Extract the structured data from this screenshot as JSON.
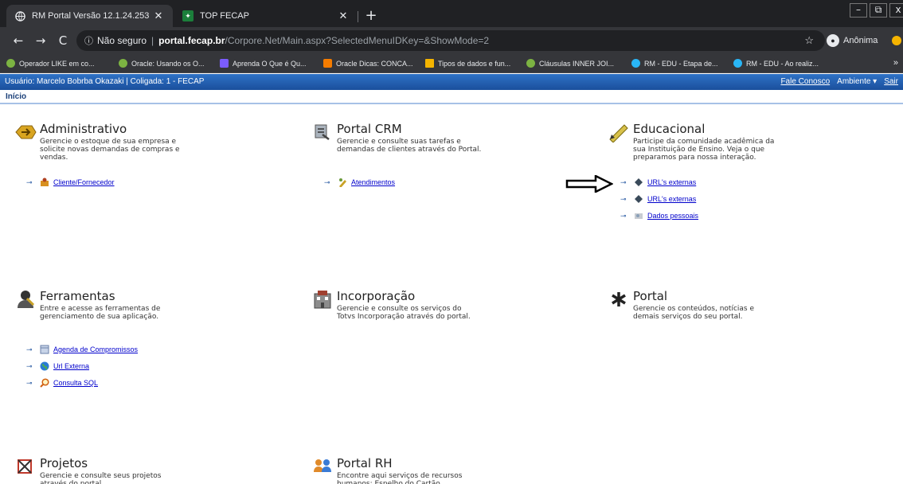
{
  "browser": {
    "tabs": [
      {
        "title": "RM Portal Versão 12.1.24.253",
        "active": true
      },
      {
        "title": "TOP FECAP",
        "active": false
      }
    ],
    "window_controls": [
      "–",
      "⧉",
      "x"
    ],
    "address": {
      "security": "Não seguro",
      "host": "portal.fecap.br",
      "path": "/Corpore.Net/Main.aspx?SelectedMenuIDKey=&ShowMode=2"
    },
    "incognito_label": "Anônima",
    "bookmarks": [
      {
        "label": "Operador LIKE em co...",
        "color": "#7cb342"
      },
      {
        "label": "Oracle: Usando os O...",
        "color": "#7cb342"
      },
      {
        "label": "Aprenda O Que é Qu...",
        "color": "#7b5cff"
      },
      {
        "label": "Oracle Dicas: CONCA...",
        "color": "#f57c00"
      },
      {
        "label": "Tipos de dados e fun...",
        "color": "#f4b400"
      },
      {
        "label": "Cláusulas INNER JOI...",
        "color": "#7cb342"
      },
      {
        "label": "RM - EDU - Etapa de...",
        "color": "#29b6f6"
      },
      {
        "label": "RM - EDU - Ao realiz...",
        "color": "#29b6f6"
      }
    ],
    "bookmarks_more": "»"
  },
  "portal": {
    "user_info": "Usuário: Marcelo Bobrba Okazaki  |  Coligada: 1 - FECAP",
    "fale_conosco": "Fale Conosco",
    "ambiente": "Ambiente ▾",
    "sair": "Sair",
    "breadcrumb": "Início",
    "modules": {
      "administrativo": {
        "title": "Administrativo",
        "desc": "Gerencie o estoque de sua empresa e solicite novas demandas de compras e vendas.",
        "links": [
          "Cliente/Fornecedor"
        ]
      },
      "crm": {
        "title": "Portal CRM",
        "desc": "Gerencie e consulte suas tarefas e demandas de clientes através do Portal.",
        "links": [
          "Atendimentos"
        ]
      },
      "educacional": {
        "title": "Educacional",
        "desc": "Participe da comunidade acadêmica da sua Instituição de Ensino. Veja o que preparamos para nossa interação.",
        "links": [
          "URL's externas",
          "URL's externas",
          "Dados pessoais"
        ]
      },
      "ferramentas": {
        "title": "Ferramentas",
        "desc": "Entre e acesse as ferramentas de gerenciamento de sua aplicação.",
        "links": [
          "Agenda de Compromissos",
          "Url Externa",
          "Consulta SQL"
        ]
      },
      "incorporacao": {
        "title": "Incorporação",
        "desc": "Gerencie e consulte os serviços do Totvs Incorporação através do portal."
      },
      "portal": {
        "title": "Portal",
        "desc": "Gerencie os conteúdos, notícias e demais serviços do seu portal."
      },
      "projetos": {
        "title": "Projetos",
        "desc": "Gerencie e consulte seus projetos através do portal."
      },
      "rh": {
        "title": "Portal RH",
        "desc": "Encontre aqui serviços de recursos humanos: Espelho do Cartão"
      }
    }
  }
}
